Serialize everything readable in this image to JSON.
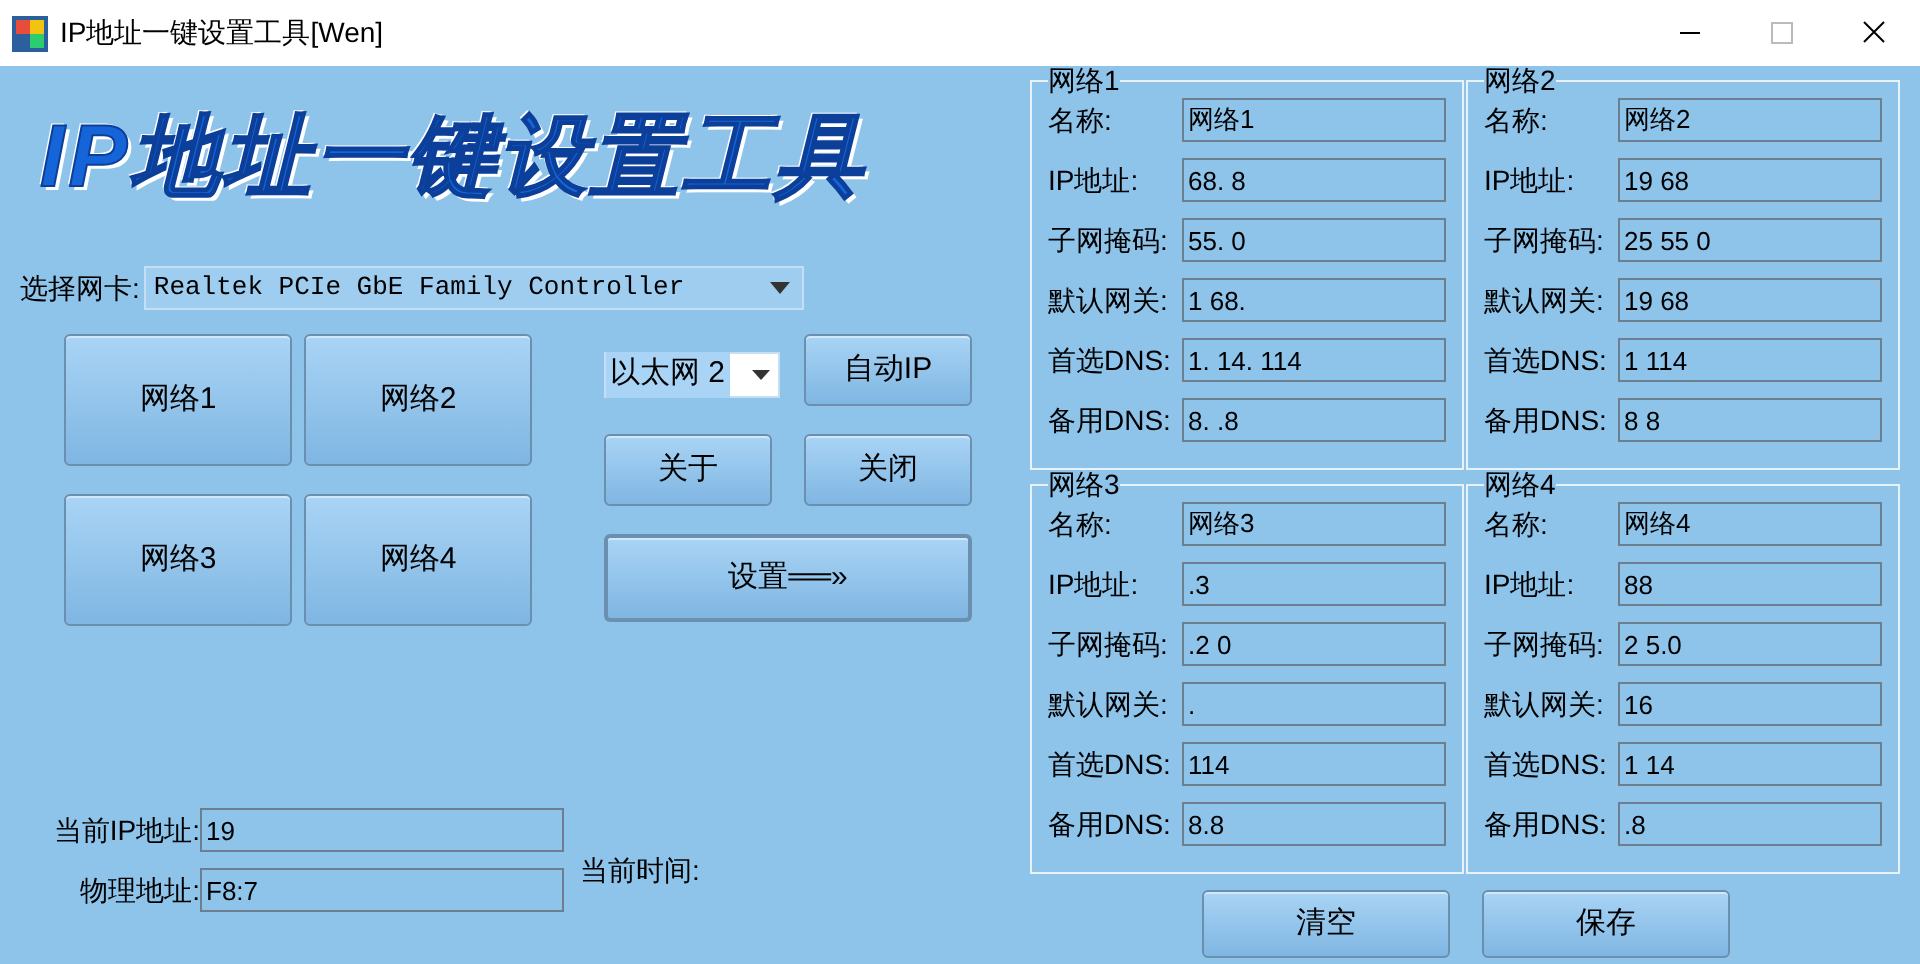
{
  "window": {
    "title": "IP地址一键设置工具[Wen]"
  },
  "banner": "IP地址一键设置工具",
  "adapter": {
    "label": "选择网卡:",
    "value": "Realtek PCIe GbE Family Controller"
  },
  "network_buttons": [
    "网络1",
    "网络2",
    "网络3",
    "网络4"
  ],
  "connection": {
    "value": "以太网 2"
  },
  "buttons": {
    "auto_ip": "自动IP",
    "about": "关于",
    "close": "关闭",
    "apply": "设置══»"
  },
  "current_ip": {
    "label": "当前IP地址:",
    "value": "19"
  },
  "mac": {
    "label": "物理地址:",
    "value": "F8:7"
  },
  "time_label": "当前时间:",
  "groups": [
    {
      "title": "网络1",
      "fields": [
        {
          "label": "名称:",
          "value": "网络1"
        },
        {
          "label": "IP地址:",
          "value": "68. 8"
        },
        {
          "label": "子网掩码:",
          "value": "55. 0"
        },
        {
          "label": "默认网关:",
          "value": "1 68."
        },
        {
          "label": "首选DNS:",
          "value": "1. 14. 114"
        },
        {
          "label": "备用DNS:",
          "value": "8. .8"
        }
      ]
    },
    {
      "title": "网络2",
      "fields": [
        {
          "label": "名称:",
          "value": "网络2"
        },
        {
          "label": "IP地址:",
          "value": "19 68"
        },
        {
          "label": "子网掩码:",
          "value": "25 55 0"
        },
        {
          "label": "默认网关:",
          "value": "19 68"
        },
        {
          "label": "首选DNS:",
          "value": "1 114"
        },
        {
          "label": "备用DNS:",
          "value": "8 8"
        }
      ]
    },
    {
      "title": "网络3",
      "fields": [
        {
          "label": "名称:",
          "value": "网络3"
        },
        {
          "label": "IP地址:",
          "value": ".3"
        },
        {
          "label": "子网掩码:",
          "value": ".2 0"
        },
        {
          "label": "默认网关:",
          "value": "."
        },
        {
          "label": "首选DNS:",
          "value": "114"
        },
        {
          "label": "备用DNS:",
          "value": "8.8"
        }
      ]
    },
    {
      "title": "网络4",
      "fields": [
        {
          "label": "名称:",
          "value": "网络4"
        },
        {
          "label": "IP地址:",
          "value": "88"
        },
        {
          "label": "子网掩码:",
          "value": "2 5.0"
        },
        {
          "label": "默认网关:",
          "value": "16"
        },
        {
          "label": "首选DNS:",
          "value": "1 14"
        },
        {
          "label": "备用DNS:",
          "value": ".8"
        }
      ]
    }
  ],
  "bottom_buttons": [
    "清空",
    "保存"
  ]
}
